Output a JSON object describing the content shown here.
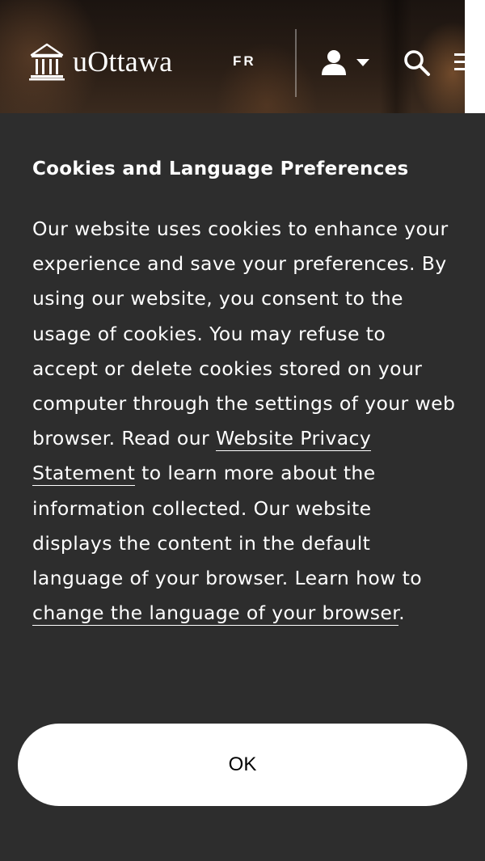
{
  "header": {
    "logo_text": "uOttawa",
    "language_toggle": "FR"
  },
  "cookie_banner": {
    "title": "Cookies and Language Preferences",
    "body_part1": "Our website uses cookies to enhance your experience and save your preferences. By using our website, you consent to the usage of cookies. You may refuse to accept or delete cookies stored on your computer through the settings of your web browser. Read our ",
    "privacy_link": "Website Privacy Statement",
    "body_part2": " to learn more about the information collected. Our website displays the content in the default language of your browser. Learn how to ",
    "language_link": "change the language of your browser",
    "body_end": ".",
    "ok_label": "OK"
  }
}
